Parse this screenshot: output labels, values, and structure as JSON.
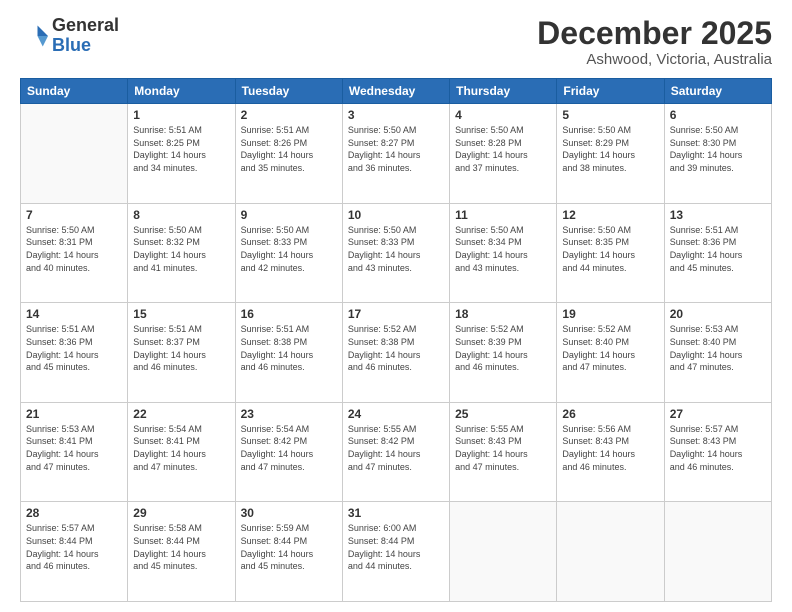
{
  "logo": {
    "general": "General",
    "blue": "Blue"
  },
  "header": {
    "month_title": "December 2025",
    "subtitle": "Ashwood, Victoria, Australia"
  },
  "days_of_week": [
    "Sunday",
    "Monday",
    "Tuesday",
    "Wednesday",
    "Thursday",
    "Friday",
    "Saturday"
  ],
  "weeks": [
    [
      {
        "day": "",
        "info": ""
      },
      {
        "day": "1",
        "info": "Sunrise: 5:51 AM\nSunset: 8:25 PM\nDaylight: 14 hours\nand 34 minutes."
      },
      {
        "day": "2",
        "info": "Sunrise: 5:51 AM\nSunset: 8:26 PM\nDaylight: 14 hours\nand 35 minutes."
      },
      {
        "day": "3",
        "info": "Sunrise: 5:50 AM\nSunset: 8:27 PM\nDaylight: 14 hours\nand 36 minutes."
      },
      {
        "day": "4",
        "info": "Sunrise: 5:50 AM\nSunset: 8:28 PM\nDaylight: 14 hours\nand 37 minutes."
      },
      {
        "day": "5",
        "info": "Sunrise: 5:50 AM\nSunset: 8:29 PM\nDaylight: 14 hours\nand 38 minutes."
      },
      {
        "day": "6",
        "info": "Sunrise: 5:50 AM\nSunset: 8:30 PM\nDaylight: 14 hours\nand 39 minutes."
      }
    ],
    [
      {
        "day": "7",
        "info": "Sunrise: 5:50 AM\nSunset: 8:31 PM\nDaylight: 14 hours\nand 40 minutes."
      },
      {
        "day": "8",
        "info": "Sunrise: 5:50 AM\nSunset: 8:32 PM\nDaylight: 14 hours\nand 41 minutes."
      },
      {
        "day": "9",
        "info": "Sunrise: 5:50 AM\nSunset: 8:33 PM\nDaylight: 14 hours\nand 42 minutes."
      },
      {
        "day": "10",
        "info": "Sunrise: 5:50 AM\nSunset: 8:33 PM\nDaylight: 14 hours\nand 43 minutes."
      },
      {
        "day": "11",
        "info": "Sunrise: 5:50 AM\nSunset: 8:34 PM\nDaylight: 14 hours\nand 43 minutes."
      },
      {
        "day": "12",
        "info": "Sunrise: 5:50 AM\nSunset: 8:35 PM\nDaylight: 14 hours\nand 44 minutes."
      },
      {
        "day": "13",
        "info": "Sunrise: 5:51 AM\nSunset: 8:36 PM\nDaylight: 14 hours\nand 45 minutes."
      }
    ],
    [
      {
        "day": "14",
        "info": "Sunrise: 5:51 AM\nSunset: 8:36 PM\nDaylight: 14 hours\nand 45 minutes."
      },
      {
        "day": "15",
        "info": "Sunrise: 5:51 AM\nSunset: 8:37 PM\nDaylight: 14 hours\nand 46 minutes."
      },
      {
        "day": "16",
        "info": "Sunrise: 5:51 AM\nSunset: 8:38 PM\nDaylight: 14 hours\nand 46 minutes."
      },
      {
        "day": "17",
        "info": "Sunrise: 5:52 AM\nSunset: 8:38 PM\nDaylight: 14 hours\nand 46 minutes."
      },
      {
        "day": "18",
        "info": "Sunrise: 5:52 AM\nSunset: 8:39 PM\nDaylight: 14 hours\nand 46 minutes."
      },
      {
        "day": "19",
        "info": "Sunrise: 5:52 AM\nSunset: 8:40 PM\nDaylight: 14 hours\nand 47 minutes."
      },
      {
        "day": "20",
        "info": "Sunrise: 5:53 AM\nSunset: 8:40 PM\nDaylight: 14 hours\nand 47 minutes."
      }
    ],
    [
      {
        "day": "21",
        "info": "Sunrise: 5:53 AM\nSunset: 8:41 PM\nDaylight: 14 hours\nand 47 minutes."
      },
      {
        "day": "22",
        "info": "Sunrise: 5:54 AM\nSunset: 8:41 PM\nDaylight: 14 hours\nand 47 minutes."
      },
      {
        "day": "23",
        "info": "Sunrise: 5:54 AM\nSunset: 8:42 PM\nDaylight: 14 hours\nand 47 minutes."
      },
      {
        "day": "24",
        "info": "Sunrise: 5:55 AM\nSunset: 8:42 PM\nDaylight: 14 hours\nand 47 minutes."
      },
      {
        "day": "25",
        "info": "Sunrise: 5:55 AM\nSunset: 8:43 PM\nDaylight: 14 hours\nand 47 minutes."
      },
      {
        "day": "26",
        "info": "Sunrise: 5:56 AM\nSunset: 8:43 PM\nDaylight: 14 hours\nand 46 minutes."
      },
      {
        "day": "27",
        "info": "Sunrise: 5:57 AM\nSunset: 8:43 PM\nDaylight: 14 hours\nand 46 minutes."
      }
    ],
    [
      {
        "day": "28",
        "info": "Sunrise: 5:57 AM\nSunset: 8:44 PM\nDaylight: 14 hours\nand 46 minutes."
      },
      {
        "day": "29",
        "info": "Sunrise: 5:58 AM\nSunset: 8:44 PM\nDaylight: 14 hours\nand 45 minutes."
      },
      {
        "day": "30",
        "info": "Sunrise: 5:59 AM\nSunset: 8:44 PM\nDaylight: 14 hours\nand 45 minutes."
      },
      {
        "day": "31",
        "info": "Sunrise: 6:00 AM\nSunset: 8:44 PM\nDaylight: 14 hours\nand 44 minutes."
      },
      {
        "day": "",
        "info": ""
      },
      {
        "day": "",
        "info": ""
      },
      {
        "day": "",
        "info": ""
      }
    ]
  ]
}
